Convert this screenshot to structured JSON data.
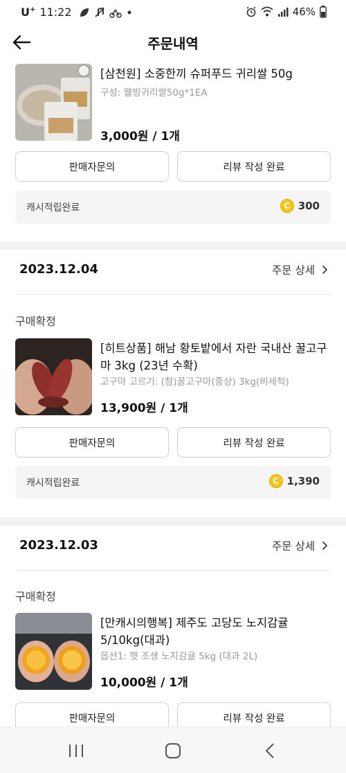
{
  "status_bar": {
    "carrier": "U",
    "carrier_sup": "+",
    "time": "11:22",
    "battery": "46%",
    "left_icons": [
      "leaf-icon",
      "no-music-icon",
      "bike-icon",
      "dot-icon"
    ],
    "right_icons": [
      "alarm-icon",
      "wifi-icon",
      "signal-icon",
      "battery-icon"
    ]
  },
  "header": {
    "title": "주문내역",
    "back_icon": "arrow-left-icon"
  },
  "orders": [
    {
      "item": {
        "title": "[삼천원] 소중한끼 슈퍼푸드 귀리쌀 50g",
        "option": "구성: 웰빙귀리쌀50g*1EA",
        "price": "3,000원 / 1개"
      },
      "buttons": {
        "inquiry": "판매자문의",
        "review": "리뷰 작성 완료"
      },
      "cash": {
        "label": "캐시적립완료",
        "amount": "300",
        "coin_icon": "coin-icon"
      }
    },
    {
      "date": "2023.12.04",
      "detail_label": "주문 상세",
      "status": "구매확정",
      "item": {
        "title": "[히트상품] 해남 황토밭에서 자란 국내산 꿀고구마 3kg (23년 수확)",
        "option": "고구마 고르기: (참)꿀고구마(중상) 3kg(비세척)",
        "price": "13,900원 / 1개"
      },
      "buttons": {
        "inquiry": "판매자문의",
        "review": "리뷰 작성 완료"
      },
      "cash": {
        "label": "캐시적립완료",
        "amount": "1,390",
        "coin_icon": "coin-icon"
      }
    },
    {
      "date": "2023.12.03",
      "detail_label": "주문 상세",
      "status": "구매확정",
      "item": {
        "title": "[만캐시의행복] 제주도 고당도 노지감귤 5/10kg(대과)",
        "option": "옵션1: 햇 조생 노지감귤 5kg (대과 2L)",
        "price": "10,000원 / 1개"
      },
      "buttons": {
        "inquiry": "판매자문의",
        "review": "리뷰 작성 완료"
      }
    }
  ],
  "nav": {
    "recents_icon": "recents-icon",
    "home_icon": "home-icon",
    "back_icon": "back-icon"
  },
  "colors": {
    "coin": "#f5c518",
    "band": "#f2f2f2",
    "cash_bg": "#f5f5f5"
  }
}
